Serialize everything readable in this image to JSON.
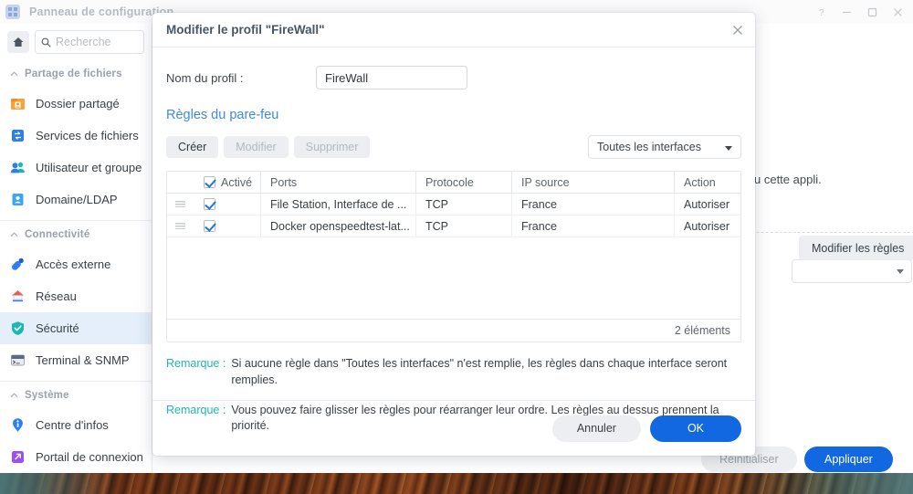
{
  "window": {
    "title": "Panneau de configuration",
    "controls": [
      {
        "name": "help",
        "glyph": "?"
      },
      {
        "name": "minimize",
        "glyph": "–"
      },
      {
        "name": "maximize",
        "glyph": "▢"
      },
      {
        "name": "close",
        "glyph": "✕"
      }
    ]
  },
  "sidebar": {
    "search_placeholder": "Recherche",
    "search_value": "",
    "groups": [
      {
        "title": "Partage de fichiers",
        "items": [
          {
            "label": "Dossier partagé",
            "icon": "folder-icon",
            "color": "#f0912b",
            "selected": false
          },
          {
            "label": "Services de fichiers",
            "icon": "file-service-icon",
            "color": "#1a73e8",
            "selected": false
          },
          {
            "label": "Utilisateur et groupe",
            "icon": "users-icon",
            "color": "#18b9b0",
            "selected": false
          },
          {
            "label": "Domaine/LDAP",
            "icon": "domain-icon",
            "color": "#3fa5f0",
            "selected": false
          }
        ]
      },
      {
        "title": "Connectivité",
        "items": [
          {
            "label": "Accès externe",
            "icon": "external-access-icon",
            "color": "#1a73e8",
            "selected": false
          },
          {
            "label": "Réseau",
            "icon": "network-icon",
            "color": "#e8604c",
            "selected": false
          },
          {
            "label": "Sécurité",
            "icon": "shield-icon",
            "color": "#18b9b0",
            "selected": true
          },
          {
            "label": "Terminal & SNMP",
            "icon": "terminal-icon",
            "color": "#5b6b80",
            "selected": false
          }
        ]
      },
      {
        "title": "Système",
        "items": [
          {
            "label": "Centre d'infos",
            "icon": "info-icon",
            "color": "#2b7ff0",
            "selected": false
          },
          {
            "label": "Portail de connexion",
            "icon": "login-portal-icon",
            "color": "#9a4ff0",
            "selected": false
          }
        ]
      }
    ]
  },
  "background": {
    "clipped_text": "u cette appli.",
    "edit_rules_button": "Modifier les règles",
    "reset_button": "Réinitialiser",
    "apply_button": "Appliquer"
  },
  "dialog": {
    "title": "Modifier le profil \"FireWall\"",
    "close_glyph": "✕",
    "profile_name_label": "Nom du profil :",
    "profile_name_value": "FireWall",
    "rules_heading": "Règles du pare-feu",
    "toolbar": {
      "create_label": "Créer",
      "modify_label": "Modifier",
      "delete_label": "Supprimer",
      "interface_select_value": "Toutes les interfaces"
    },
    "table": {
      "headers": {
        "enabled": "Activé",
        "ports": "Ports",
        "protocol": "Protocole",
        "source_ip": "IP source",
        "action": "Action"
      },
      "header_checkbox_checked": true,
      "rows": [
        {
          "enabled": true,
          "ports": "File Station, Interface de ...",
          "protocol": "TCP",
          "source_ip": "France",
          "action": "Autoriser"
        },
        {
          "enabled": true,
          "ports": "Docker openspeedtest-lat...",
          "protocol": "TCP",
          "source_ip": "France",
          "action": "Autoriser"
        }
      ],
      "items_count": "2 éléments"
    },
    "remarks": [
      {
        "label": "Remarque :",
        "text": "Si aucune règle dans \"Toutes les interfaces\" n'est remplie, les règles dans chaque interface seront remplies."
      },
      {
        "label": "Remarque :",
        "text": "Vous pouvez faire glisser les règles pour réarranger leur ordre. Les règles au dessus prennent la priorité."
      }
    ],
    "cancel_label": "Annuler",
    "ok_label": "OK"
  },
  "colors": {
    "accent_blue": "#1268e0",
    "link_blue": "#3f8ae0",
    "remark_teal": "#23b5ad",
    "selected_row": "#e4effb"
  }
}
